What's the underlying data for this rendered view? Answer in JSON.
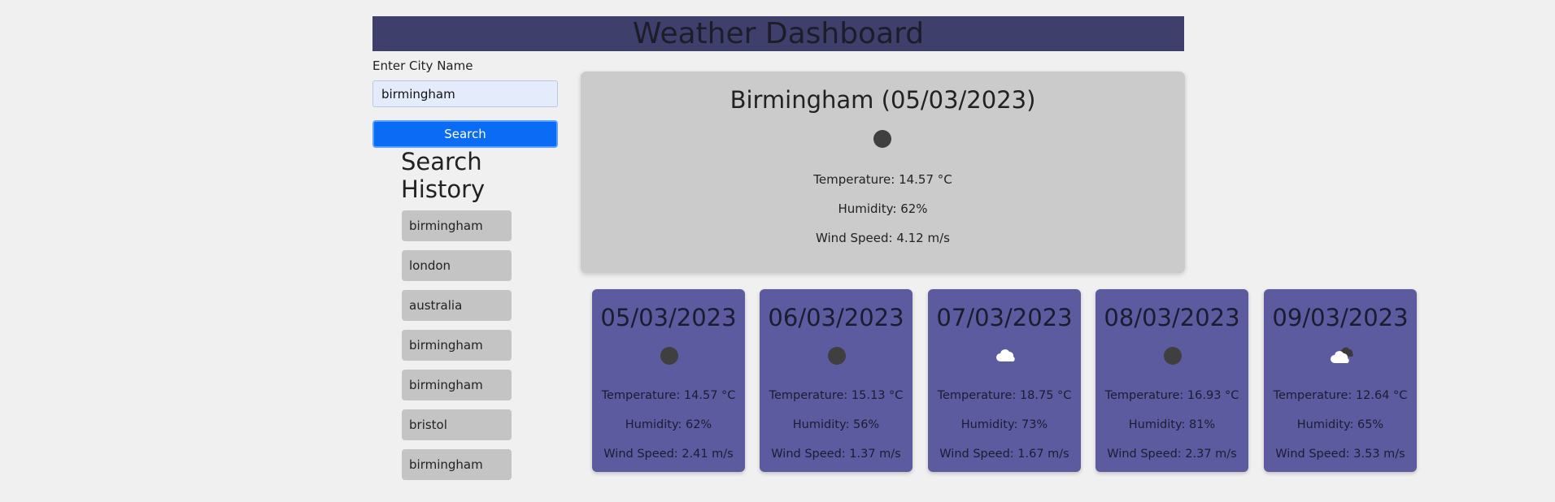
{
  "header": {
    "title": "Weather Dashboard"
  },
  "search": {
    "label": "Enter City Name",
    "value": "birmingham",
    "button_label": "Search"
  },
  "history": {
    "title": "Search History",
    "items": [
      {
        "label": "birmingham"
      },
      {
        "label": "london"
      },
      {
        "label": "australia"
      },
      {
        "label": "birmingham"
      },
      {
        "label": "birmingham"
      },
      {
        "label": "bristol"
      },
      {
        "label": "birmingham"
      }
    ]
  },
  "current": {
    "title": "Birmingham (05/03/2023)",
    "icon": "dark-circle-icon",
    "temperature": "Temperature: 14.57 °C",
    "humidity": "Humidity: 62%",
    "wind": "Wind Speed: 4.12 m/s"
  },
  "forecast": [
    {
      "date": "05/03/2023",
      "icon": "dark-circle-icon",
      "temperature": "Temperature: 14.57 °C",
      "humidity": "Humidity: 62%",
      "wind": "Wind Speed: 2.41 m/s"
    },
    {
      "date": "06/03/2023",
      "icon": "dark-circle-icon",
      "temperature": "Temperature: 15.13 °C",
      "humidity": "Humidity: 56%",
      "wind": "Wind Speed: 1.37 m/s"
    },
    {
      "date": "07/03/2023",
      "icon": "cloud-icon",
      "temperature": "Temperature: 18.75 °C",
      "humidity": "Humidity: 73%",
      "wind": "Wind Speed: 1.67 m/s"
    },
    {
      "date": "08/03/2023",
      "icon": "dark-circle-icon",
      "temperature": "Temperature: 16.93 °C",
      "humidity": "Humidity: 81%",
      "wind": "Wind Speed: 2.37 m/s"
    },
    {
      "date": "09/03/2023",
      "icon": "broken-clouds-icon",
      "temperature": "Temperature: 12.64 °C",
      "humidity": "Humidity: 65%",
      "wind": "Wind Speed: 3.53 m/s"
    }
  ],
  "colors": {
    "header_bg": "#3f3f6b",
    "current_bg": "#cbcbcb",
    "forecast_bg": "#5d5ba0",
    "button_bg": "#0a6cf5",
    "history_item_bg": "#c4c4c4"
  }
}
